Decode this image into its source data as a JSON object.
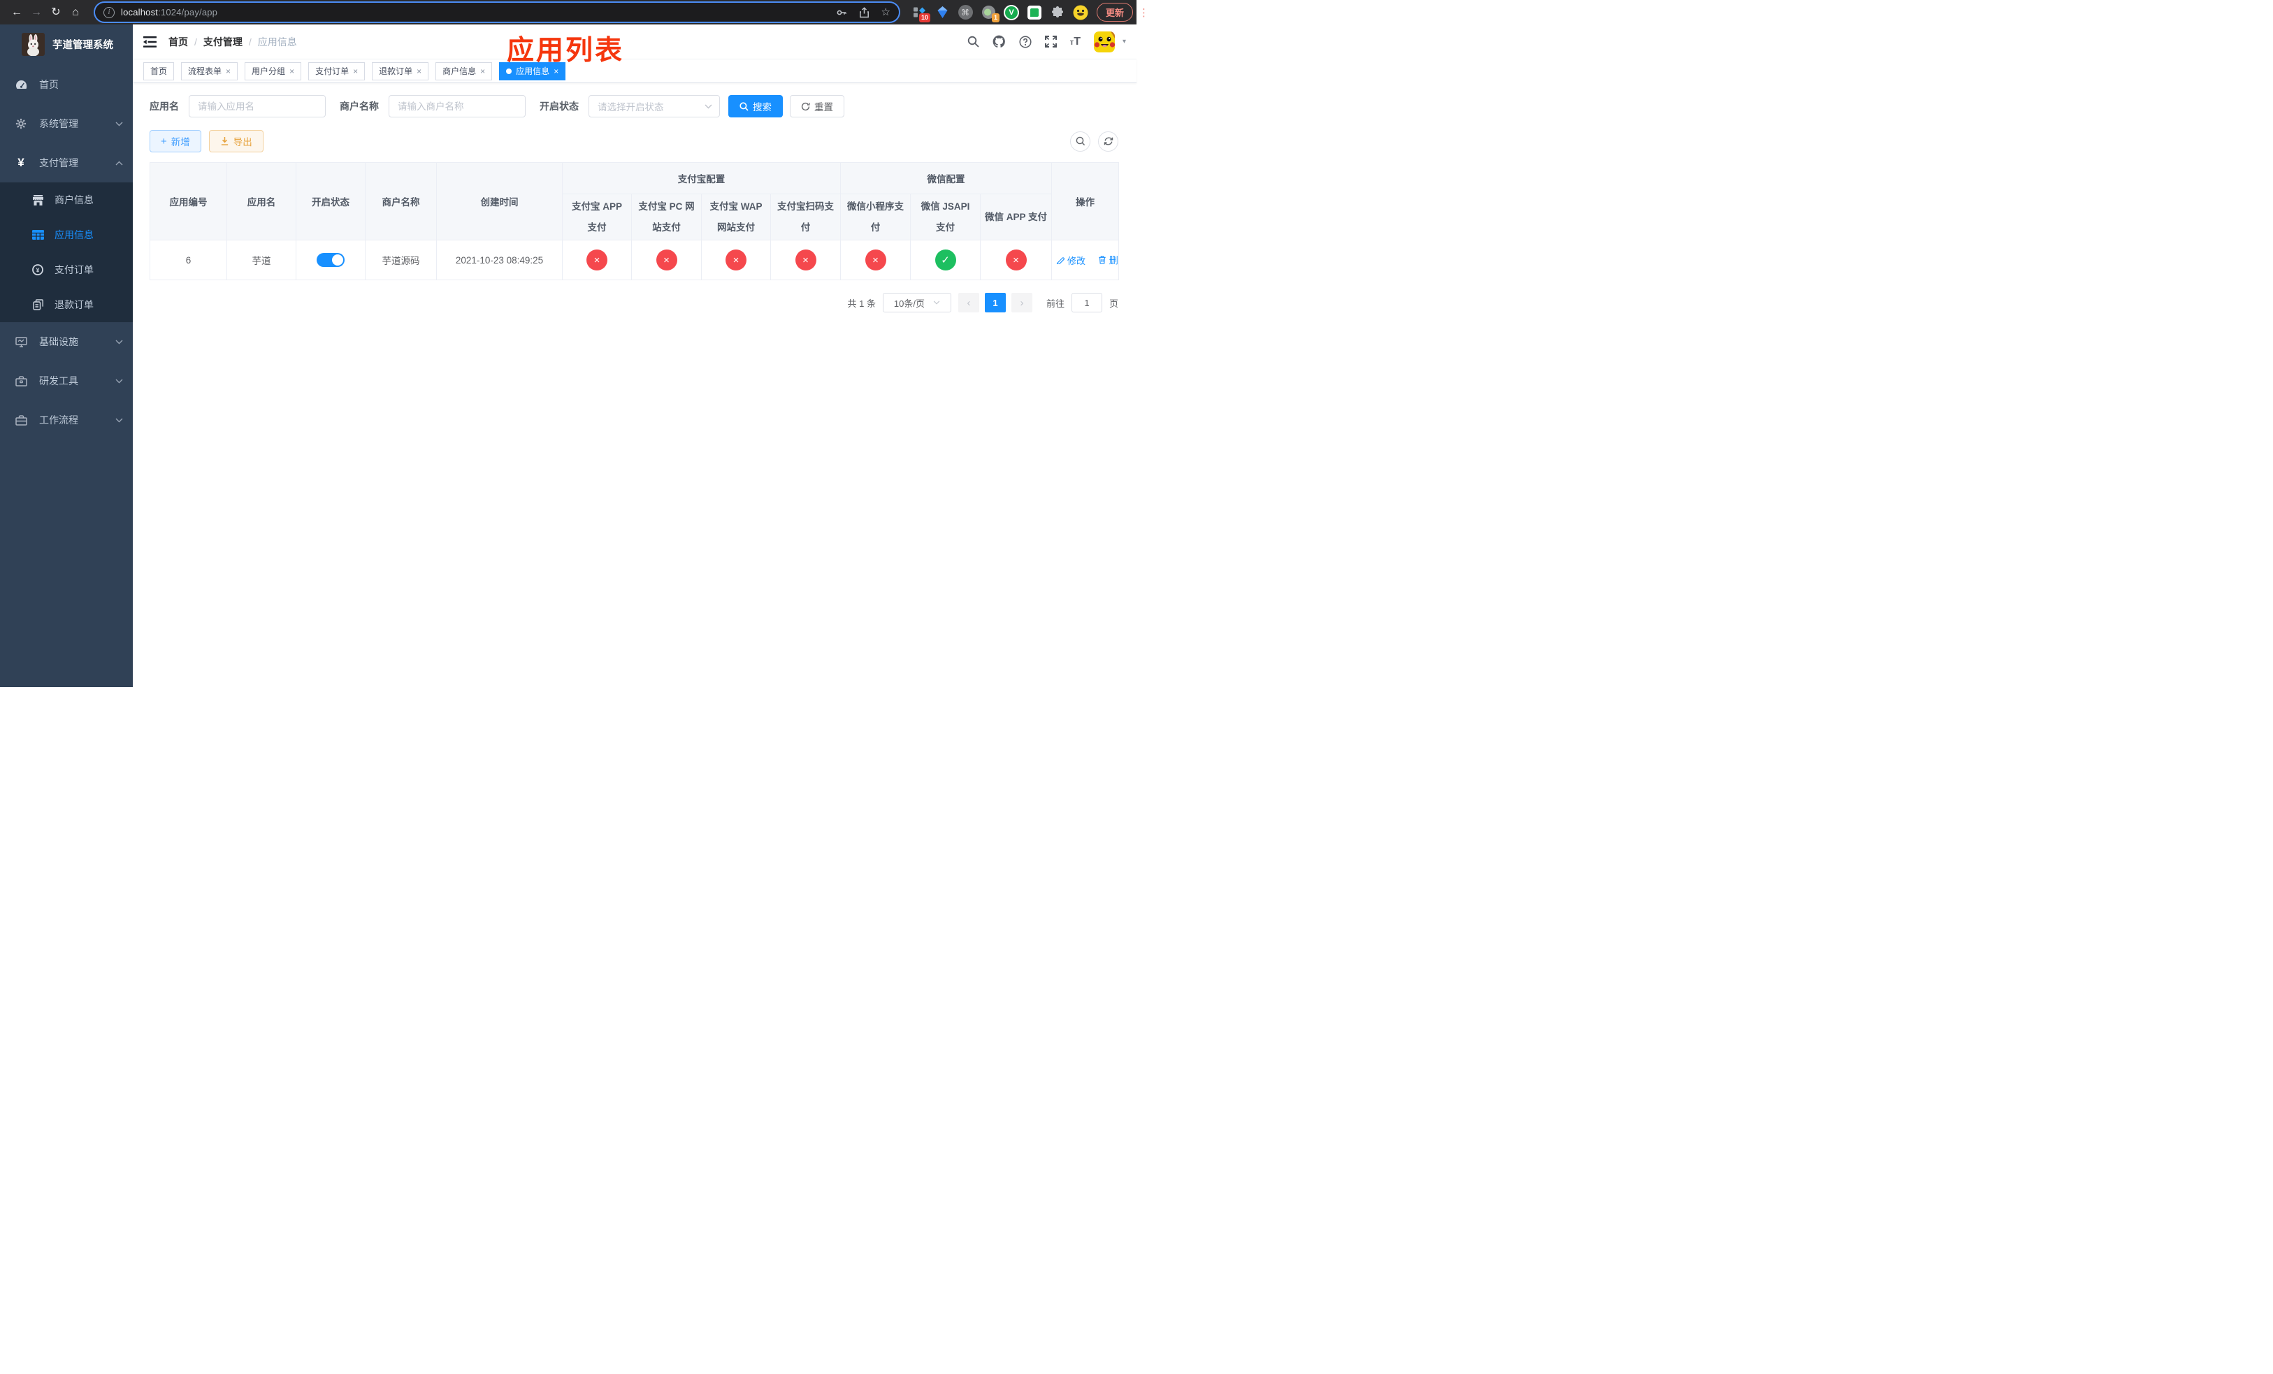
{
  "colors": {
    "accent": "#1890ff",
    "success": "#1dbf60",
    "danger": "#f5484d",
    "warning": "#e6a23c",
    "sidebar_bg": "#304156",
    "submenu_bg": "#1f2d3d"
  },
  "browser": {
    "url_host": "localhost",
    "url_path": ":1024/pay/app",
    "update_button": "更新",
    "ext_badge_tiles": "10",
    "ext_badge_capture": "1"
  },
  "sidebar": {
    "title": "芋道管理系统",
    "items": [
      {
        "label": "首页",
        "icon": "dashboard-icon"
      },
      {
        "label": "系统管理",
        "icon": "gear-icon",
        "expandable": true
      },
      {
        "label": "支付管理",
        "icon": "yen-icon",
        "expandable": true,
        "expanded": true,
        "children": [
          {
            "label": "商户信息",
            "icon": "shop-icon"
          },
          {
            "label": "应用信息",
            "icon": "grid-icon",
            "active": true
          },
          {
            "label": "支付订单",
            "icon": "pay-circle-icon"
          },
          {
            "label": "退款订单",
            "icon": "document-icon"
          }
        ]
      },
      {
        "label": "基础设施",
        "icon": "monitor-icon",
        "expandable": true
      },
      {
        "label": "研发工具",
        "icon": "toolbox-icon",
        "expandable": true
      },
      {
        "label": "工作流程",
        "icon": "briefcase-icon",
        "expandable": true
      }
    ]
  },
  "navbar": {
    "breadcrumb": [
      "首页",
      "支付管理",
      "应用信息"
    ]
  },
  "annotation": "应用列表",
  "tabs": [
    {
      "label": "首页",
      "closable": false,
      "active": false
    },
    {
      "label": "流程表单",
      "closable": true,
      "active": false
    },
    {
      "label": "用户分组",
      "closable": true,
      "active": false
    },
    {
      "label": "支付订单",
      "closable": true,
      "active": false
    },
    {
      "label": "退款订单",
      "closable": true,
      "active": false
    },
    {
      "label": "商户信息",
      "closable": true,
      "active": false
    },
    {
      "label": "应用信息",
      "closable": true,
      "active": true
    }
  ],
  "filters": {
    "app_name_label": "应用名",
    "app_name_placeholder": "请输入应用名",
    "merchant_label": "商户名称",
    "merchant_placeholder": "请输入商户名称",
    "status_label": "开启状态",
    "status_placeholder": "请选择开启状态",
    "search_button": "搜索",
    "reset_button": "重置"
  },
  "toolbar": {
    "add_button": "新增",
    "export_button": "导出"
  },
  "table": {
    "columns": {
      "app_id": "应用编号",
      "app_name": "应用名",
      "enabled": "开启状态",
      "merchant": "商户名称",
      "created": "创建时间",
      "alipay_group": "支付宝配置",
      "wechat_group": "微信配置",
      "alipay_app": "支付宝 APP 支付",
      "alipay_pc": "支付宝 PC 网站支付",
      "alipay_wap": "支付宝 WAP 网站支付",
      "alipay_qr": "支付宝扫码支付",
      "wx_mini": "微信小程序支付",
      "wx_jsapi": "微信 JSAPI 支付",
      "wx_app": "微信 APP 支付",
      "ops": "操作"
    },
    "row": {
      "app_id": "6",
      "app_name": "芋道",
      "enabled": true,
      "merchant": "芋道源码",
      "created": "2021-10-23 08:49:25",
      "statuses": [
        "fail",
        "fail",
        "fail",
        "fail",
        "fail",
        "success",
        "fail"
      ],
      "edit": "修改",
      "delete": "删除"
    }
  },
  "pagination": {
    "total": "共 1 条",
    "page_size": "10条/页",
    "prev": "‹",
    "page": "1",
    "next": "›",
    "goto_label": "前往",
    "goto_value": "1",
    "unit": "页"
  }
}
